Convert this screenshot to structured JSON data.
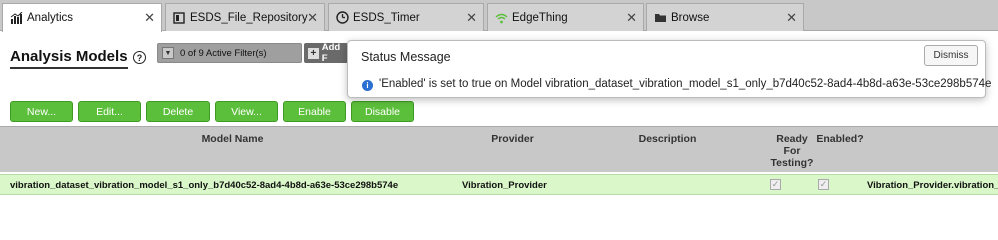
{
  "tabs": [
    {
      "label": "Analytics",
      "icon": "bar-chart-icon",
      "active": true
    },
    {
      "label": "ESDS_File_Repository",
      "icon": "database-icon",
      "active": false
    },
    {
      "label": "ESDS_Timer",
      "icon": "clock-icon",
      "active": false
    },
    {
      "label": "EdgeThing",
      "icon": "wifi-icon",
      "active": false
    },
    {
      "label": "Browse",
      "icon": "folder-icon",
      "active": false
    }
  ],
  "page": {
    "title": "Analysis Models",
    "filter_text": "0 of 9 Active Filter(s)",
    "add_filter_label": "Add F"
  },
  "buttons": {
    "new": "New...",
    "edit": "Edit...",
    "delete": "Delete",
    "view": "View...",
    "enable": "Enable",
    "disable": "Disable"
  },
  "grid": {
    "headers": {
      "model_name": "Model Name",
      "provider": "Provider",
      "description": "Description",
      "ready_for_testing": "Ready For Testing?",
      "enabled": "Enabled?"
    },
    "rows": [
      {
        "model_name": "vibration_dataset_vibration_model_s1_only_b7d40c52-8ad4-4b8d-a63e-53ce298b574e",
        "provider": "Vibration_Provider",
        "description": "",
        "ready_for_testing": true,
        "enabled": true,
        "extra": "Vibration_Provider.vibration_da"
      }
    ]
  },
  "status_message": {
    "title": "Status Message",
    "dismiss_label": "Dismiss",
    "message": "'Enabled' is set to true on Model vibration_dataset_vibration_model_s1_only_b7d40c52-8ad4-4b8d-a63e-53ce298b574e"
  },
  "colors": {
    "button_green": "#5cbf3b",
    "row_highlight": "#d9f7c8",
    "header_gray": "#c8c8c8"
  }
}
